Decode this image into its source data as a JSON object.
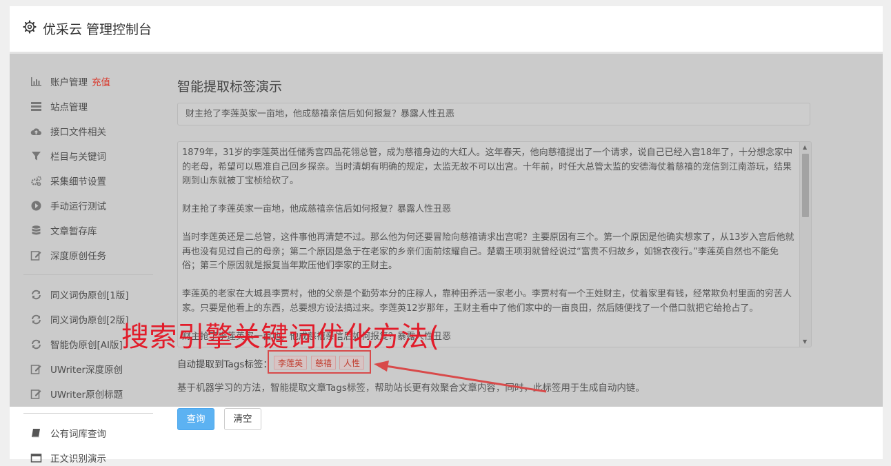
{
  "header": {
    "title": "优采云 管理控制台"
  },
  "sidebar": {
    "items": [
      {
        "label": "账户管理",
        "badge": "充值",
        "icon": "bar-chart-icon"
      },
      {
        "label": "站点管理",
        "icon": "list-icon"
      },
      {
        "label": "接口文件相关",
        "icon": "cloud-upload-icon"
      },
      {
        "label": "栏目与关键词",
        "icon": "filter-icon"
      },
      {
        "label": "采集细节设置",
        "icon": "gears-icon"
      },
      {
        "label": "手动运行测试",
        "icon": "play-circle-icon"
      },
      {
        "label": "文章暂存库",
        "icon": "database-icon"
      },
      {
        "label": "深度原创任务",
        "icon": "edit-icon"
      },
      {
        "label": "同义词伪原创[1版]",
        "icon": "refresh-icon"
      },
      {
        "label": "同义词伪原创[2版]",
        "icon": "refresh-icon"
      },
      {
        "label": "智能伪原创[AI版]",
        "icon": "refresh-icon"
      },
      {
        "label": "UWriter深度原创",
        "icon": "edit-icon"
      },
      {
        "label": "UWriter原创标题",
        "icon": "edit-icon"
      },
      {
        "label": "公有词库查询",
        "icon": "book-icon"
      },
      {
        "label": "正文识别演示",
        "icon": "window-icon"
      }
    ]
  },
  "main": {
    "title": "智能提取标签演示",
    "title_input": "财主抢了李莲英家一亩地，他成慈禧亲信后如何报复？暴露人性丑恶",
    "content_paragraphs": [
      "1879年，31岁的李莲英出任储秀宫四品花翎总管，成为慈禧身边的大红人。这年春天，他向慈禧提出了一个请求，说自己已经入宫18年了，十分想念家中的老母，希望可以恩准自己回乡探亲。当时清朝有明确的规定，太监无故不可以出宫。十年前，时任大总管太监的安德海仗着慈禧的宠信到江南游玩，结果刚到山东就被丁宝桢给砍了。",
      "财主抢了李莲英家一亩地，他成慈禧亲信后如何报复？暴露人性丑恶",
      "当时李莲英还是二总管，这件事他再清楚不过。那么他为何还要冒险向慈禧请求出宫呢？主要原因有三个。第一个原因是他确实想家了，从13岁入宫后他就再也没有见过自己的母亲；第二个原因是急于在老家的乡亲们面前炫耀自己。楚霸王项羽就曾经说过“富贵不归故乡，如锦衣夜行。”李莲英自然也不能免俗；第三个原因就是报复当年欺压他们李家的王财主。",
      "李莲英的老家在大城县李贾村，他的父亲是个勤劳本分的庄稼人，靠种田养活一家老小。李贾村有一个王姓财主，仗着家里有钱，经常欺负村里面的穷苦人家。只要是他看上的东西，总要想方设法搞过来。李莲英12岁那年，王财主看中了他们家中的一亩良田，然后随便找了一个借口就把它给抢占了。",
      "财主抢了李莲英家一亩地，他成慈禧亲信后如何报复？暴露人性丑恶"
    ],
    "tags_label": "自动提取到Tags标签：",
    "tags": [
      "李莲英",
      "慈禧",
      "人性"
    ],
    "description": "基于机器学习的方法，智能提取文章Tags标签，帮助站长更有效聚合文章内容，同时，此标签用于生成自动内链。",
    "query_button": "查询",
    "clear_button": "清空"
  },
  "overlay": {
    "watermark": "搜索引擎关键词优化方法("
  },
  "colors": {
    "accent_blue": "#5cb2f2",
    "badge_red": "#d9372b",
    "annotation_red": "#e21c2a"
  }
}
